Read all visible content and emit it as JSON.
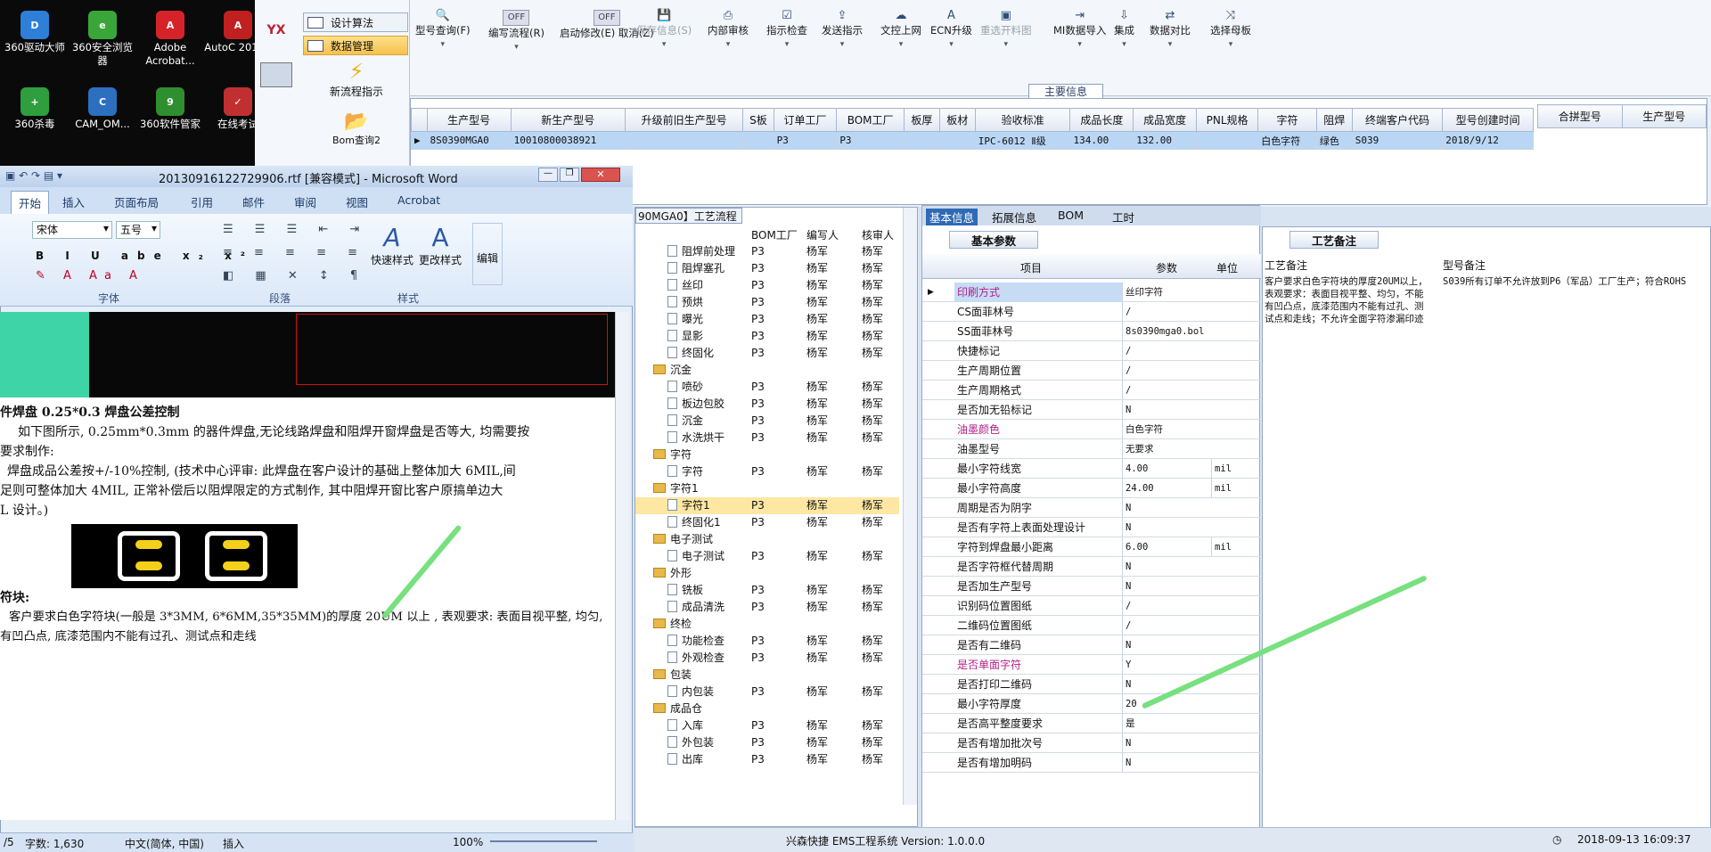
{
  "desktop": {
    "icons": [
      {
        "label": "360驱动大师",
        "color": "#2e7fd8",
        "glyph": "D"
      },
      {
        "label": "360安全浏览器",
        "color": "#3aa63a",
        "glyph": "e"
      },
      {
        "label": "Adobe Acrobat...",
        "color": "#d6232a",
        "glyph": "A"
      },
      {
        "label": "AutoC 2014 -",
        "color": "#c02020",
        "glyph": "A"
      },
      {
        "label": "360杀毒",
        "color": "#2e9e3e",
        "glyph": "+"
      },
      {
        "label": "CAM_OM...",
        "color": "#2d6fbf",
        "glyph": "C"
      },
      {
        "label": "360软件管家",
        "color": "#2f8f2f",
        "glyph": "9"
      },
      {
        "label": "在线考试",
        "color": "#c03030",
        "glyph": "✓"
      }
    ]
  },
  "nav": {
    "items": [
      {
        "label": "设计算法"
      },
      {
        "label": "数据管理"
      }
    ],
    "new_flow": "新流程指示",
    "bom_query": "Bom查询2",
    "yx": "YX"
  },
  "toolbar": {
    "buttons": [
      {
        "label": "型号查询(F)",
        "icon": "search-icon",
        "enabled": true
      },
      {
        "label": "编写流程(R)",
        "icon": "toggle",
        "enabled": true
      },
      {
        "label": "启动修改(E) 取消(Z)",
        "icon": "toggle",
        "enabled": true
      },
      {
        "label": "保存信息(S)",
        "icon": "save-icon",
        "enabled": false
      },
      {
        "label": "内部审核",
        "icon": "print-icon",
        "enabled": true
      },
      {
        "label": "指示检查",
        "icon": "check-icon",
        "enabled": true
      },
      {
        "label": "发送指示",
        "icon": "upload-icon",
        "enabled": true
      },
      {
        "label": "文控上网",
        "icon": "cloud-icon",
        "enabled": true
      },
      {
        "label": "ECN升级",
        "icon": "a-icon",
        "enabled": true
      },
      {
        "label": "重选开料图",
        "icon": "image-icon",
        "enabled": false
      },
      {
        "label": "MI数据导入",
        "icon": "import-icon",
        "enabled": true
      },
      {
        "label": "集成",
        "icon": "download-icon",
        "enabled": true
      },
      {
        "label": "数据对比",
        "icon": "compare-icon",
        "enabled": true
      },
      {
        "label": "选择母板",
        "icon": "shuffle-icon",
        "enabled": true
      }
    ],
    "toggle_text": "OFF"
  },
  "main_info": {
    "title": "主要信息",
    "columns": [
      "生产型号",
      "新生产型号",
      "升级前旧生产型号",
      "S板",
      "订单工厂",
      "BOM工厂",
      "板厚",
      "板材",
      "验收标准",
      "成品长度",
      "成品宽度",
      "PNL规格",
      "字符",
      "阻焊",
      "终端客户代码",
      "型号创建时间"
    ],
    "row": [
      "8S0390MGA0",
      "10010800038921",
      "",
      "",
      "P3",
      "P3",
      "",
      "",
      "IPC-6012 Ⅱ级",
      "134.00",
      "132.00",
      "",
      "白色字符",
      "绿色",
      "S039",
      "2018/9/12"
    ],
    "side_columns": [
      "合拼型号",
      "生产型号"
    ]
  },
  "word": {
    "title": "20130916122729906.rtf [兼容模式] - Microsoft Word",
    "tabs": [
      "开始",
      "插入",
      "页面布局",
      "引用",
      "邮件",
      "审阅",
      "视图",
      "Acrobat"
    ],
    "font": "宋体",
    "size": "五号",
    "groups": [
      "字体",
      "段落",
      "样式",
      "编辑"
    ],
    "style_quick": "快速样式",
    "style_change": "更改样式",
    "edit": "编辑",
    "doc": {
      "h1": "件焊盘 0.25*0.3 焊盘公差控制",
      "p1": "如下图所示, 0.25mm*0.3mm 的器件焊盘,无论线路焊盘和阻焊开窗焊盘是否等大, 均需要按",
      "p1b": "要求制作:",
      "p2": "焊盘成品公差按+/-10%控制, (技术中心评审: 此焊盘在客户设计的基础上整体加大 6MIL,间",
      "p2b": "足则可整体加大 4MIL, 正常补偿后以阻焊限定的方式制作, 其中阻焊开窗比客户原搞单边大",
      "p2c": "L 设计。)",
      "h2": "符块:",
      "p3": "客户要求白色字符块(一般是 3*3MM, 6*6MM,35*35MM)的厚度 20UM 以上 , 表观要求: 表面目视平整, 均匀,",
      "p3b": "有凹凸点, 底漆范围内不能有过孔、测试点和走线"
    },
    "status": {
      "page": "/5",
      "words": "字数: 1,630",
      "lang": "中文(简体, 中国)",
      "mode": "插入",
      "zoom": "100%"
    }
  },
  "process": {
    "title": "90MGA0】工艺流程",
    "columns": [
      "BOM工厂",
      "编写人",
      "核审人"
    ],
    "rows": [
      {
        "name": "阻焊前处理",
        "level": 1,
        "folder": false,
        "f": "P3",
        "w": "杨军",
        "r": "杨军"
      },
      {
        "name": "阻焊塞孔",
        "level": 1,
        "folder": false,
        "f": "P3",
        "w": "杨军",
        "r": "杨军"
      },
      {
        "name": "丝印",
        "level": 1,
        "folder": false,
        "f": "P3",
        "w": "杨军",
        "r": "杨军"
      },
      {
        "name": "预烘",
        "level": 1,
        "folder": false,
        "f": "P3",
        "w": "杨军",
        "r": "杨军"
      },
      {
        "name": "曝光",
        "level": 1,
        "folder": false,
        "f": "P3",
        "w": "杨军",
        "r": "杨军"
      },
      {
        "name": "显影",
        "level": 1,
        "folder": false,
        "f": "P3",
        "w": "杨军",
        "r": "杨军"
      },
      {
        "name": "终固化",
        "level": 1,
        "folder": false,
        "f": "P3",
        "w": "杨军",
        "r": "杨军"
      },
      {
        "name": "沉金",
        "level": 0,
        "folder": true,
        "f": "",
        "w": "",
        "r": ""
      },
      {
        "name": "喷砂",
        "level": 1,
        "folder": false,
        "f": "P3",
        "w": "杨军",
        "r": "杨军"
      },
      {
        "name": "板边包胶",
        "level": 1,
        "folder": false,
        "f": "P3",
        "w": "杨军",
        "r": "杨军"
      },
      {
        "name": "沉金",
        "level": 1,
        "folder": false,
        "f": "P3",
        "w": "杨军",
        "r": "杨军"
      },
      {
        "name": "水洗烘干",
        "level": 1,
        "folder": false,
        "f": "P3",
        "w": "杨军",
        "r": "杨军"
      },
      {
        "name": "字符",
        "level": 0,
        "folder": true,
        "f": "",
        "w": "",
        "r": ""
      },
      {
        "name": "字符",
        "level": 1,
        "folder": false,
        "f": "P3",
        "w": "杨军",
        "r": "杨军"
      },
      {
        "name": "字符1",
        "level": 0,
        "folder": true,
        "f": "",
        "w": "",
        "r": ""
      },
      {
        "name": "字符1",
        "level": 1,
        "folder": false,
        "f": "P3",
        "w": "杨军",
        "r": "杨军",
        "sel": true
      },
      {
        "name": "终固化1",
        "level": 1,
        "folder": false,
        "f": "P3",
        "w": "杨军",
        "r": "杨军"
      },
      {
        "name": "电子测试",
        "level": 0,
        "folder": true,
        "f": "",
        "w": "",
        "r": ""
      },
      {
        "name": "电子测试",
        "level": 1,
        "folder": false,
        "f": "P3",
        "w": "杨军",
        "r": "杨军"
      },
      {
        "name": "外形",
        "level": 0,
        "folder": true,
        "f": "",
        "w": "",
        "r": ""
      },
      {
        "name": "铣板",
        "level": 1,
        "folder": false,
        "f": "P3",
        "w": "杨军",
        "r": "杨军"
      },
      {
        "name": "成品清洗",
        "level": 1,
        "folder": false,
        "f": "P3",
        "w": "杨军",
        "r": "杨军"
      },
      {
        "name": "终检",
        "level": 0,
        "folder": true,
        "f": "",
        "w": "",
        "r": ""
      },
      {
        "name": "功能检查",
        "level": 1,
        "folder": false,
        "f": "P3",
        "w": "杨军",
        "r": "杨军"
      },
      {
        "name": "外观检查",
        "level": 1,
        "folder": false,
        "f": "P3",
        "w": "杨军",
        "r": "杨军"
      },
      {
        "name": "包装",
        "level": 0,
        "folder": true,
        "f": "",
        "w": "",
        "r": ""
      },
      {
        "name": "内包装",
        "level": 1,
        "folder": false,
        "f": "P3",
        "w": "杨军",
        "r": "杨军"
      },
      {
        "name": "成品仓",
        "level": 0,
        "folder": true,
        "f": "",
        "w": "",
        "r": ""
      },
      {
        "name": "入库",
        "level": 1,
        "folder": false,
        "f": "P3",
        "w": "杨军",
        "r": "杨军"
      },
      {
        "name": "外包装",
        "level": 1,
        "folder": false,
        "f": "P3",
        "w": "杨军",
        "r": "杨军"
      },
      {
        "name": "出库",
        "level": 1,
        "folder": false,
        "f": "P3",
        "w": "杨军",
        "r": "杨军"
      }
    ]
  },
  "basic": {
    "tabs": [
      "基本信息",
      "拓展信息",
      "BOM",
      "工时"
    ],
    "sub": "基本参数",
    "columns": [
      "项目",
      "参数",
      "单位"
    ],
    "rows": [
      {
        "k": "印刷方式",
        "v": "丝印字符",
        "u": "",
        "hl": true,
        "sel": true
      },
      {
        "k": "CS面菲林号",
        "v": "/",
        "u": ""
      },
      {
        "k": "SS面菲林号",
        "v": "8s0390mga0.bol",
        "u": ""
      },
      {
        "k": "快捷标记",
        "v": "/",
        "u": ""
      },
      {
        "k": "生产周期位置",
        "v": "/",
        "u": ""
      },
      {
        "k": "生产周期格式",
        "v": "/",
        "u": ""
      },
      {
        "k": "是否加无铅标记",
        "v": "N",
        "u": ""
      },
      {
        "k": "油墨颜色",
        "v": "白色字符",
        "u": "",
        "hl": true
      },
      {
        "k": "油墨型号",
        "v": "无要求",
        "u": ""
      },
      {
        "k": "最小字符线宽",
        "v": "4.00",
        "u": "mil"
      },
      {
        "k": "最小字符高度",
        "v": "24.00",
        "u": "mil"
      },
      {
        "k": "周期是否为阴字",
        "v": "N",
        "u": ""
      },
      {
        "k": "是否有字符上表面处理设计",
        "v": "N",
        "u": ""
      },
      {
        "k": "字符到焊盘最小距离",
        "v": "6.00",
        "u": "mil"
      },
      {
        "k": "是否字符框代替周期",
        "v": "N",
        "u": ""
      },
      {
        "k": "是否加生产型号",
        "v": "N",
        "u": ""
      },
      {
        "k": "识别码位置图纸",
        "v": "/",
        "u": ""
      },
      {
        "k": "二维码位置图纸",
        "v": "/",
        "u": ""
      },
      {
        "k": "是否有二维码",
        "v": "N",
        "u": ""
      },
      {
        "k": "是否单面字符",
        "v": "Y",
        "u": "",
        "hl": true
      },
      {
        "k": "是否打印二维码",
        "v": "N",
        "u": ""
      },
      {
        "k": "最小字符厚度",
        "v": "20",
        "u": ""
      },
      {
        "k": "是否高平整度要求",
        "v": "是",
        "u": ""
      },
      {
        "k": "是否有增加批次号",
        "v": "N",
        "u": ""
      },
      {
        "k": "是否有增加明码",
        "v": "N",
        "u": ""
      }
    ]
  },
  "remark": {
    "tab": "工艺备注",
    "col1": "工艺备注",
    "col2": "型号备注",
    "text1": "客户要求白色字符块的厚度20UM以上，表观要求：表面目视平整、均匀，不能有凹凸点，底漆范围内不能有过孔、测试点和走线；不允许全面字符渗漏印迹",
    "text2": "S039所有订单不允许放到P6（军品）工厂生产；符合ROHS"
  },
  "footer": {
    "app": "兴森快捷 EMS工程系统 Version: 1.0.0.0",
    "clock": "2018-09-13 16:09:37"
  }
}
